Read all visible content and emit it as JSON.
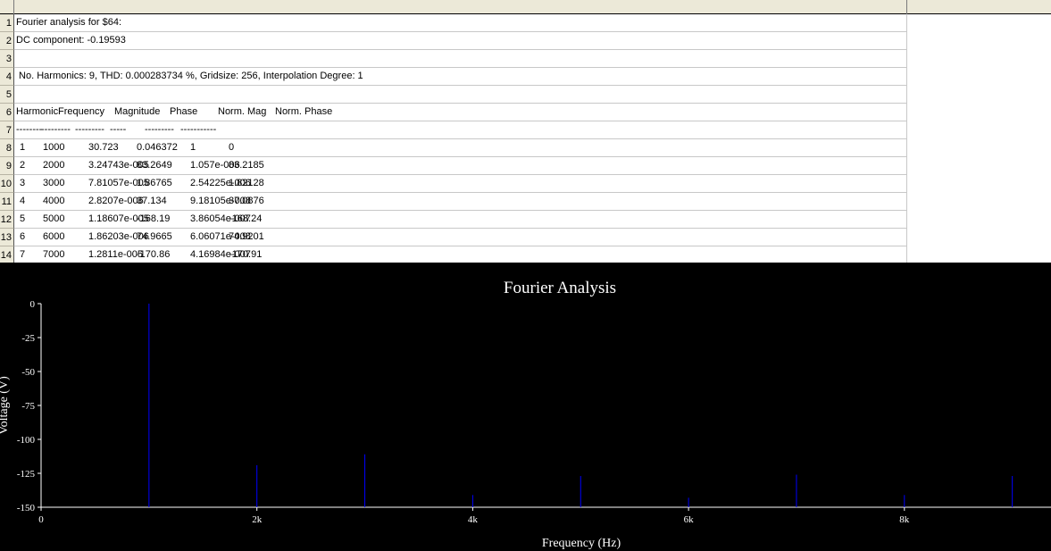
{
  "sheet": {
    "rows": [
      {
        "num": "1",
        "text": "Fourier analysis for $64:"
      },
      {
        "num": "2",
        "text": "DC component: -0.19593"
      },
      {
        "num": "3",
        "text": ""
      },
      {
        "num": "4",
        "text": " No. Harmonics: 9, THD: 0.000283734 %, Gridsize: 256, Interpolation Degree: 1"
      },
      {
        "num": "5",
        "text": ""
      },
      {
        "num": "6",
        "header": [
          "Harmonic",
          "Frequency",
          "Magnitude",
          "Phase",
          "Norm. Mag",
          "Norm. Phase"
        ]
      },
      {
        "num": "7",
        "header": [
          "--------",
          "---------",
          "---------",
          "-----",
          "---------",
          "-----------"
        ]
      },
      {
        "num": "8",
        "cols": [
          "1",
          "1000",
          "30.723",
          "0.046372",
          "1",
          "0"
        ]
      },
      {
        "num": "9",
        "cols": [
          "2",
          "2000",
          "3.24743e-005",
          "83.2649",
          "1.057e-006",
          "83.2185"
        ]
      },
      {
        "num": "10",
        "cols": [
          "3",
          "3000",
          "7.81057e-005",
          "1.86765",
          "2.54225e-006",
          "1.82128"
        ]
      },
      {
        "num": "11",
        "cols": [
          "4",
          "4000",
          "2.8207e-006",
          "37.134",
          "9.18105e-008",
          "37.0876"
        ]
      },
      {
        "num": "12",
        "cols": [
          "5",
          "5000",
          "1.18607e-005",
          "-168.19",
          "3.86054e-007",
          "-168.24"
        ]
      },
      {
        "num": "13",
        "cols": [
          "6",
          "6000",
          "1.86203e-006",
          "74.9665",
          "6.06071e-008",
          "74.9201"
        ]
      },
      {
        "num": "14",
        "cols": [
          "7",
          "7000",
          "1.2811e-005",
          "-170.86",
          "4.16984e-007",
          "-170.91"
        ]
      }
    ]
  },
  "chart_data": {
    "type": "bar",
    "title": "Fourier Analysis",
    "xlabel": "Frequency (Hz)",
    "ylabel": "Voltage (V)",
    "xlim": [
      0,
      9400
    ],
    "ylim": [
      -150,
      0
    ],
    "xticks": [
      {
        "value": 0,
        "label": "0"
      },
      {
        "value": 2000,
        "label": "2k"
      },
      {
        "value": 4000,
        "label": "4k"
      },
      {
        "value": 6000,
        "label": "6k"
      },
      {
        "value": 8000,
        "label": "8k"
      }
    ],
    "yticks": [
      {
        "value": 0,
        "label": "0"
      },
      {
        "value": -25,
        "label": "-25"
      },
      {
        "value": -50,
        "label": "-50"
      },
      {
        "value": -75,
        "label": "-75"
      },
      {
        "value": -100,
        "label": "-100"
      },
      {
        "value": -125,
        "label": "-125"
      },
      {
        "value": -150,
        "label": "-150"
      }
    ],
    "grid": false,
    "x": [
      1000,
      2000,
      3000,
      4000,
      5000,
      6000,
      7000,
      8000,
      9000
    ],
    "values": [
      0,
      -119,
      -111,
      -141,
      -127,
      -143,
      -126,
      -141,
      -127
    ],
    "colors": {
      "background": "#000000",
      "bars": "#0000ff",
      "axes": "#ffffff",
      "text": "#ffffff"
    }
  }
}
